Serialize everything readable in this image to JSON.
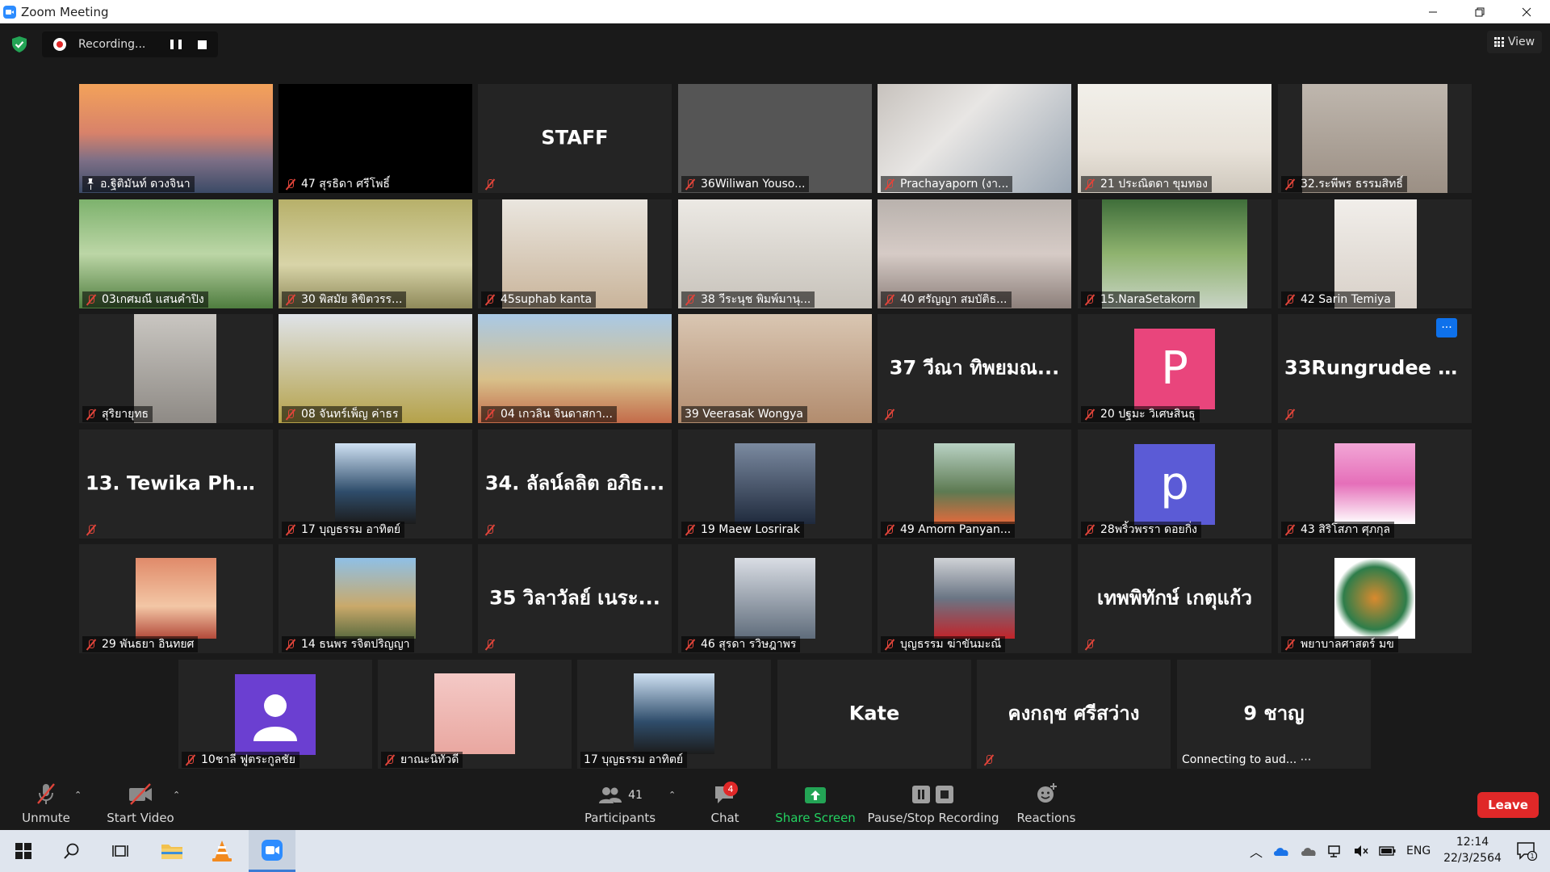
{
  "window": {
    "title": "Zoom Meeting",
    "controls": [
      "minimize",
      "restore",
      "close"
    ]
  },
  "recording": {
    "label": "Recording..."
  },
  "view_button": {
    "label": "View"
  },
  "participants_grid": [
    {
      "name": "อ.ฐิติมันท์ ดวงจินา",
      "mic_muted": false,
      "pinned": true,
      "type": "video"
    },
    {
      "name": "47 สุรธิดา  ศรีโพธิ์",
      "mic_muted": true,
      "type": "video-dark"
    },
    {
      "name": "",
      "display_name": "STAFF",
      "mic_muted": true,
      "type": "name-only"
    },
    {
      "name": "36Wiliwan Youso...",
      "mic_muted": true,
      "type": "video"
    },
    {
      "name": "Prachayaporn (งา...",
      "mic_muted": true,
      "type": "video"
    },
    {
      "name": "21 ประณิตดา ขุมทอง",
      "mic_muted": true,
      "type": "video"
    },
    {
      "name": "32.ระพีพร ธรรมสิทธิ์",
      "mic_muted": true,
      "type": "video"
    },
    {
      "name": "03เกศมณี แสนคำปิง",
      "mic_muted": true,
      "type": "video"
    },
    {
      "name": "30 พิสมัย  ลิขิตวรร...",
      "mic_muted": true,
      "type": "video"
    },
    {
      "name": "45suphab kanta",
      "mic_muted": true,
      "type": "video"
    },
    {
      "name": "38 วีระนุช พิมพ์มานุ...",
      "mic_muted": true,
      "type": "video"
    },
    {
      "name": "40 ศรัญญา  สมบัติธ...",
      "mic_muted": true,
      "type": "video"
    },
    {
      "name": "15.NaraSetakorn",
      "mic_muted": true,
      "type": "video"
    },
    {
      "name": "42  Sarin Temiya",
      "mic_muted": true,
      "type": "video"
    },
    {
      "name": "สุริยายุทธ",
      "mic_muted": true,
      "type": "video"
    },
    {
      "name": "08 จันทร์เพ็ญ  ค่าธร",
      "mic_muted": true,
      "type": "video"
    },
    {
      "name": "04 เกวลิน จินดาสกา...",
      "mic_muted": true,
      "type": "video"
    },
    {
      "name": "39 Veerasak Wongya",
      "mic_muted": false,
      "active_speaker": true,
      "type": "video"
    },
    {
      "name": "",
      "display_name": "37 วีณา  ทิพยมณ...",
      "mic_muted": true,
      "type": "name-only"
    },
    {
      "name": "20 ปฐมะ วิเศษสินธุ",
      "avatar_letter": "P",
      "mic_muted": true,
      "type": "letter"
    },
    {
      "name": "",
      "display_name": "33Rungrudee R...",
      "mic_muted": true,
      "type": "name-only",
      "more_button": "···"
    },
    {
      "name": "",
      "display_name": "13. Tewika Phoe...",
      "mic_muted": true,
      "type": "name-only"
    },
    {
      "name": "17 บุญธรรม อาทิตย์",
      "mic_muted": true,
      "type": "photo"
    },
    {
      "name": "",
      "display_name": "34. ลัลน์ลลิต อภิธ...",
      "mic_muted": true,
      "type": "name-only"
    },
    {
      "name": "19 Maew Losrirak",
      "mic_muted": true,
      "type": "photo"
    },
    {
      "name": "49 Amorn Panyan...",
      "mic_muted": true,
      "type": "photo"
    },
    {
      "name": "28พริ้วพรรา ดอยกิ่ง",
      "avatar_letter": "p",
      "mic_muted": true,
      "type": "letter"
    },
    {
      "name": "43 สิริโสภา ศุภกุล",
      "mic_muted": true,
      "type": "photo"
    },
    {
      "name": "29 พันธยา อินทยศ",
      "mic_muted": true,
      "type": "photo"
    },
    {
      "name": "14 ธนพร รจิตปริญญา",
      "mic_muted": true,
      "type": "photo"
    },
    {
      "name": "",
      "display_name": "35 วิลาวัลย์  เนระ...",
      "mic_muted": true,
      "type": "name-only"
    },
    {
      "name": "46 สุรดา รวิษฎาพร",
      "mic_muted": true,
      "type": "photo"
    },
    {
      "name": "บุญธรรม ฆ่าขันมะณี",
      "mic_muted": true,
      "type": "photo"
    },
    {
      "name": "",
      "display_name": "เทพพิทักษ์  เกตุแก้ว",
      "mic_muted": true,
      "type": "name-only"
    },
    {
      "name": "พยาบาลศาสตร์ มข",
      "mic_muted": true,
      "type": "photo"
    },
    {
      "name": "10ชาลี ฟูตระกูลชัย",
      "mic_muted": true,
      "type": "user-icon"
    },
    {
      "name": "ยาณะนิทัวดี",
      "mic_muted": true,
      "type": "photo"
    },
    {
      "name": "17 บุญธรรม อาทิตย์",
      "mic_muted": false,
      "type": "photo"
    },
    {
      "name": "",
      "display_name": "Kate",
      "mic_muted": false,
      "type": "name-only"
    },
    {
      "name": "",
      "display_name": "คงกฤช ศรีสว่าง",
      "mic_muted": true,
      "type": "name-only"
    },
    {
      "name": "",
      "display_name": "9 ชาญ",
      "status": "Connecting to aud... ⋯",
      "mic_muted": false,
      "type": "name-only"
    }
  ],
  "toolbar": {
    "unmute": "Unmute",
    "start_video": "Start Video",
    "participants_label": "Participants",
    "participants_count": "41",
    "chat": "Chat",
    "chat_badge": "4",
    "share_screen": "Share Screen",
    "pause_stop_recording": "Pause/Stop Recording",
    "reactions": "Reactions",
    "leave": "Leave"
  },
  "taskbar": {
    "language": "ENG",
    "time": "12:14",
    "date": "22/3/2564",
    "notification_count": "1"
  },
  "colors": {
    "accent_blue": "#2d8cff",
    "leave_red": "#e02828",
    "share_green": "#23d160",
    "active_speaker": "#e5e57a",
    "tile_bg": "#242424"
  }
}
